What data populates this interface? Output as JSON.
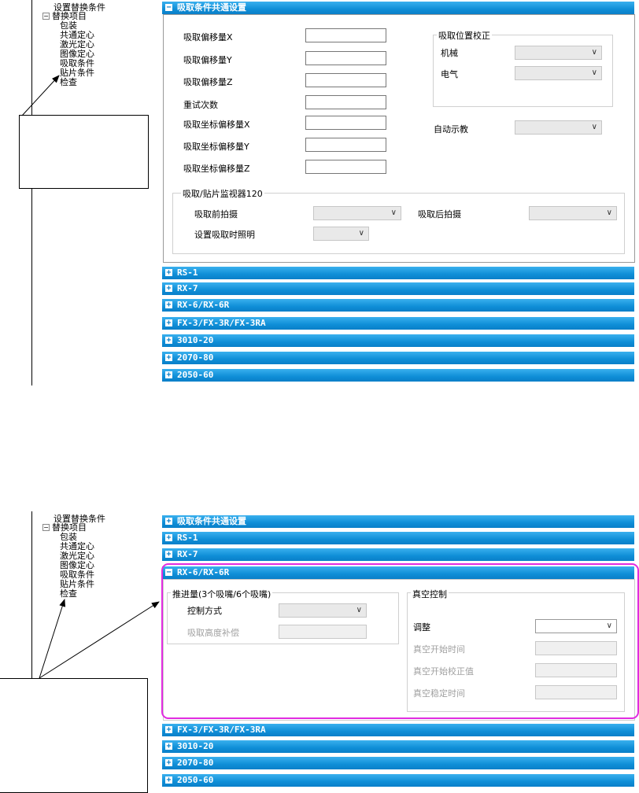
{
  "tree": {
    "root": "设置替换条件",
    "group": "替换项目",
    "items": [
      "包装",
      "共通定心",
      "激光定心",
      "图像定心",
      "吸取条件",
      "贴片条件",
      "检查"
    ]
  },
  "top": {
    "sections": {
      "common": "吸取条件共通设置",
      "s1": "RS-1",
      "s2": "RX-7",
      "s3": "RX-6/RX-6R",
      "s4": "FX-3/FX-3R/FX-3RA",
      "s5": "3010-20",
      "s6": "2070-80",
      "s7": "2050-60"
    },
    "fields": {
      "offset_x": "吸取偏移量X",
      "offset_y": "吸取偏移量Y",
      "offset_z": "吸取偏移量Z",
      "retry": "重试次数",
      "coord_x": "吸取坐标偏移量X",
      "coord_y": "吸取坐标偏移量Y",
      "coord_z": "吸取坐标偏移量Z"
    },
    "correction": {
      "title": "吸取位置校正",
      "mechanical": "机械",
      "electrical": "电气"
    },
    "auto_teach": "自动示教",
    "monitor": {
      "title": "吸取/贴片监视器120",
      "before": "吸取前拍摄",
      "after": "吸取后拍摄",
      "lighting": "设置吸取时照明"
    }
  },
  "bottom": {
    "sections": {
      "common": "吸取条件共通设置",
      "s1": "RS-1",
      "s2": "RX-7",
      "s3": "RX-6/RX-6R",
      "s4": "FX-3/FX-3R/FX-3RA",
      "s5": "3010-20",
      "s6": "2070-80",
      "s7": "2050-60"
    },
    "push": {
      "title": "推进量(3个吸嘴/6个吸嘴)",
      "control": "控制方式",
      "height_comp": "吸取高度补偿"
    },
    "vacuum": {
      "title": "真空控制",
      "adjust": "调整",
      "start_time": "真空开始时间",
      "start_corr": "真空开始校正值",
      "stable_time": "真空稳定时间"
    }
  },
  "colors": {
    "bar": "#0f8ed7",
    "highlight": "#e12ce0"
  }
}
